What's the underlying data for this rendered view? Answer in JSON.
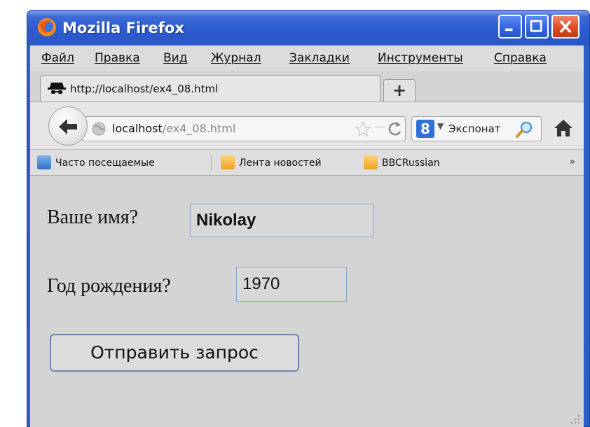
{
  "window": {
    "title": "Mozilla Firefox"
  },
  "menu": {
    "items": [
      {
        "label": "Файл"
      },
      {
        "label": "Правка"
      },
      {
        "label": "Вид"
      },
      {
        "label": "Журнал"
      },
      {
        "label": "Закладки"
      },
      {
        "label": "Инструменты"
      },
      {
        "label": "Справка"
      }
    ]
  },
  "tabs": {
    "active_title": "http://localhost/ex4_08.html",
    "new_tab_label": "+"
  },
  "navbar": {
    "url_domain": "localhost",
    "url_path": "/ex4_08.html",
    "search_engine_label": "8",
    "search_text": "Экспонат"
  },
  "bookmarks": {
    "items": [
      {
        "label": "Часто посещаемые"
      },
      {
        "label": "Лента новостей"
      },
      {
        "label": "BBCRussian"
      }
    ],
    "more_label": "»"
  },
  "form": {
    "name_label": "Ваше имя?",
    "name_value": "Nikolay",
    "year_label": "Год рождения?",
    "year_value": "1970",
    "submit_label": "Отправить запрос"
  },
  "colors": {
    "titlebar": "#2c5bd0",
    "close_button": "#e04a23",
    "page_background": "#d4d4d4"
  },
  "icons": {
    "app": "firefox-icon",
    "tab": "spy-icon",
    "back": "back-arrow-icon",
    "site": "globe-icon",
    "bookmark_star": "star-icon",
    "reload": "reload-icon",
    "search": "magnifier-icon",
    "home": "home-icon"
  }
}
